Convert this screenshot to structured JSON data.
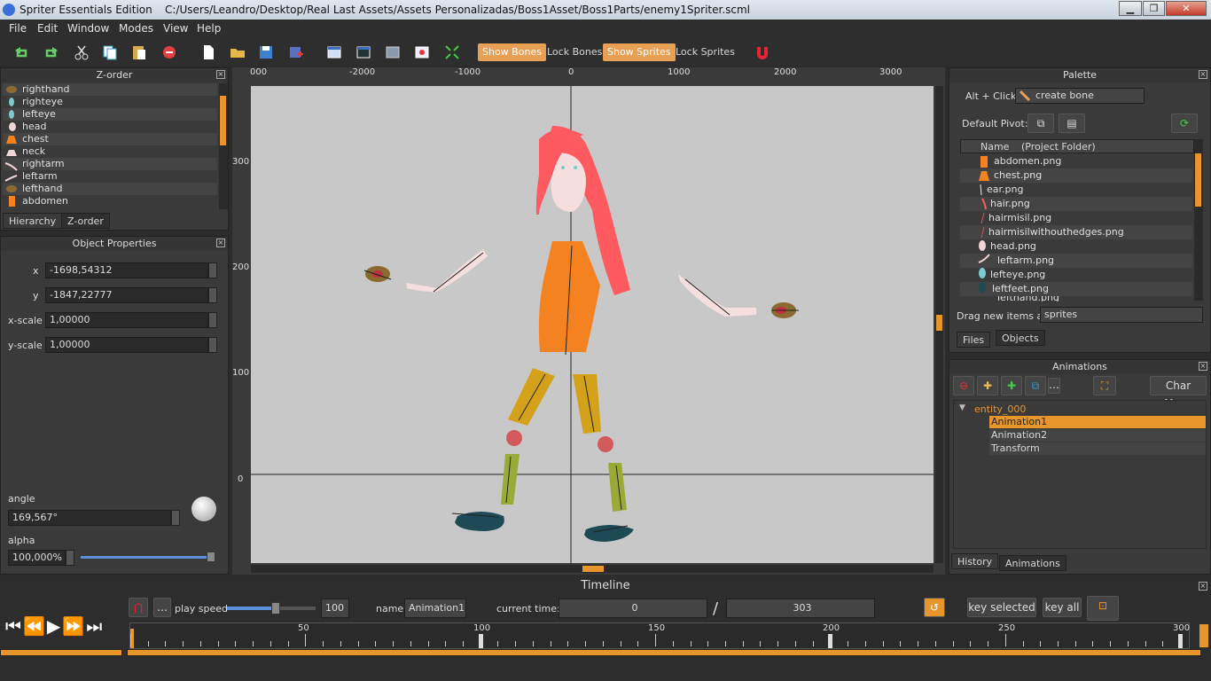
{
  "window": {
    "app_name": "Spriter Essentials Edition",
    "file_path": "C:/Users/Leandro/Desktop/Real Last Assets/Assets Personalizadas/Boss1Asset/Boss1Parts/enemy1Spriter.scml"
  },
  "menu": [
    "File",
    "Edit",
    "Window",
    "Modes",
    "View",
    "Help"
  ],
  "toolbar": {
    "show_bones": "Show Bones",
    "lock_bones": "Lock Bones",
    "show_sprites": "Show Sprites",
    "lock_sprites": "Lock Sprites"
  },
  "zorder": {
    "title": "Z-order",
    "items": [
      "righthand",
      "righteye",
      "lefteye",
      "head",
      "chest",
      "neck",
      "rightarm",
      "leftarm",
      "lefthand",
      "abdomen"
    ],
    "tabs": [
      "Hierarchy",
      "Z-order"
    ]
  },
  "object_properties": {
    "title": "Object Properties",
    "x_label": "x",
    "x_value": "-1698,54312",
    "y_label": "y",
    "y_value": "-1847,22777",
    "xscale_label": "x-scale",
    "xscale_value": "1,00000",
    "yscale_label": "y-scale",
    "yscale_value": "1,00000",
    "angle_label": "angle",
    "angle_value": "169,567°",
    "alpha_label": "alpha",
    "alpha_value": "100,000%"
  },
  "canvas": {
    "ruler_top": [
      "000",
      "-2000",
      "-1000",
      "0",
      "1000",
      "2000",
      "3000"
    ],
    "ruler_left": [
      "300",
      "200",
      "100",
      "0"
    ]
  },
  "palette": {
    "title": "Palette",
    "alt_click_label": "Alt + Click:",
    "alt_click_value": "create bone",
    "default_pivot_label": "Default Pivot:",
    "col_name": "Name",
    "col_folder": "(Project Folder)",
    "files": [
      "abdomen.png",
      "chest.png",
      "ear.png",
      "hair.png",
      "hairmisil.png",
      "hairmisilwithouthedges.png",
      "head.png",
      "leftarm.png",
      "lefteye.png",
      "leftfeet.png",
      "lefthand.png"
    ],
    "drag_label": "Drag new items as",
    "drag_value": "sprites",
    "tabs": [
      "Files",
      "Objects"
    ]
  },
  "animations": {
    "title": "Animations",
    "char_maps": "Char Maps",
    "entity": "entity_000",
    "items": [
      "Animation1",
      "Animation2",
      "Transform"
    ],
    "tabs": [
      "History",
      "Animations"
    ]
  },
  "timeline": {
    "title": "Timeline",
    "play_speed_label": "play speed",
    "play_speed_value": "100",
    "play_speed_fraction": 0.55,
    "name_label": "name",
    "name_value": "Animation1",
    "current_time_label": "current time:",
    "current_time": "0",
    "slash": "/",
    "end_time": "303",
    "key_selected": "key selected",
    "key_all": "key all",
    "ticks": [
      "50",
      "100",
      "150",
      "200",
      "250",
      "300"
    ]
  },
  "colors": {
    "accent": "#e8a055",
    "selection": "#e8962c",
    "canvas_bg": "#c8c8c8"
  }
}
